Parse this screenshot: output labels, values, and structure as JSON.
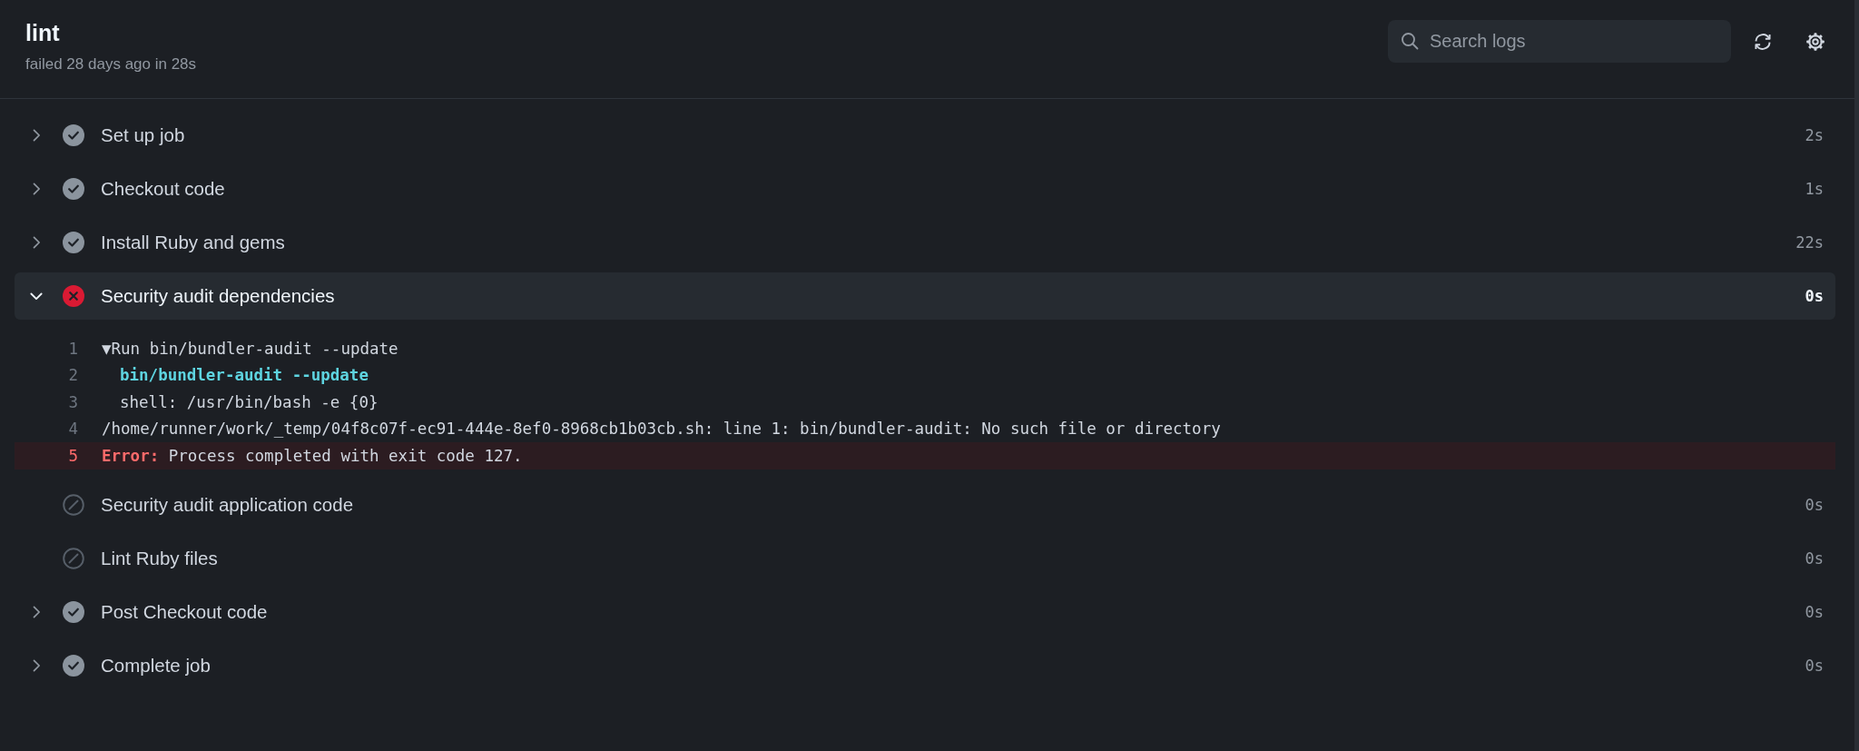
{
  "job": {
    "title": "lint",
    "summary": "failed 28 days ago in 28s"
  },
  "search": {
    "placeholder": "Search logs"
  },
  "steps": [
    {
      "name": "Set up job",
      "kind": "success",
      "duration": "2s",
      "expandable": true,
      "expanded": false
    },
    {
      "name": "Checkout code",
      "kind": "success",
      "duration": "1s",
      "expandable": true,
      "expanded": false
    },
    {
      "name": "Install Ruby and gems",
      "kind": "success",
      "duration": "22s",
      "expandable": true,
      "expanded": false
    },
    {
      "name": "Security audit dependencies",
      "kind": "failure",
      "duration": "0s",
      "expandable": true,
      "expanded": true,
      "log": [
        {
          "number": "1",
          "kind": "group",
          "text": "▼Run bin/bundler-audit --update"
        },
        {
          "number": "2",
          "kind": "command",
          "text": "bin/bundler-audit --update"
        },
        {
          "number": "3",
          "kind": "indented",
          "text": "shell: /usr/bin/bash -e {0}"
        },
        {
          "number": "4",
          "kind": "plain",
          "text": "/home/runner/work/_temp/04f8c07f-ec91-444e-8ef0-8968cb1b03cb.sh: line 1: bin/bundler-audit: No such file or directory"
        },
        {
          "number": "5",
          "kind": "error",
          "label": "Error:",
          "text": "Process completed with exit code 127."
        }
      ]
    },
    {
      "name": "Security audit application code",
      "kind": "skipped",
      "duration": "0s",
      "expandable": false,
      "expanded": false
    },
    {
      "name": "Lint Ruby files",
      "kind": "skipped",
      "duration": "0s",
      "expandable": false,
      "expanded": false
    },
    {
      "name": "Post Checkout code",
      "kind": "success",
      "duration": "0s",
      "expandable": true,
      "expanded": false
    },
    {
      "name": "Complete job",
      "kind": "success",
      "duration": "0s",
      "expandable": true,
      "expanded": false
    }
  ]
}
